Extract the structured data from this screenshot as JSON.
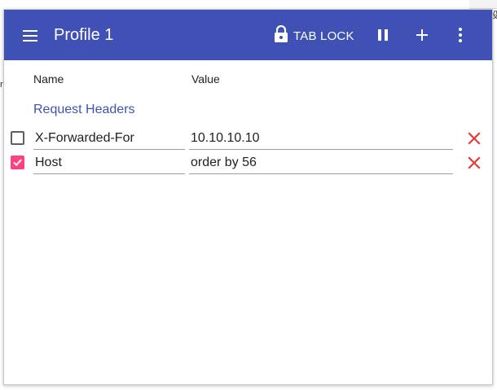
{
  "background_glyphs": {
    "left": "r",
    "right": "设"
  },
  "toolbar": {
    "title": "Profile 1",
    "tab_lock_label": "TAB LOCK",
    "color": "#3f51b5"
  },
  "columns": {
    "name": "Name",
    "value": "Value"
  },
  "section": {
    "title": "Request Headers"
  },
  "headers": [
    {
      "enabled": false,
      "name": "X-Forwarded-For",
      "value": "10.10.10.10"
    },
    {
      "enabled": true,
      "name": "Host",
      "value": "order by 56"
    }
  ],
  "icons": {
    "menu": "menu-icon",
    "lock": "lock-icon",
    "pause": "pause-icon",
    "add": "plus-icon",
    "more": "more-vert-icon",
    "delete": "close-icon"
  },
  "colors": {
    "accent": "#ff4081",
    "delete": "#e53935",
    "section": "#3f51b5"
  }
}
